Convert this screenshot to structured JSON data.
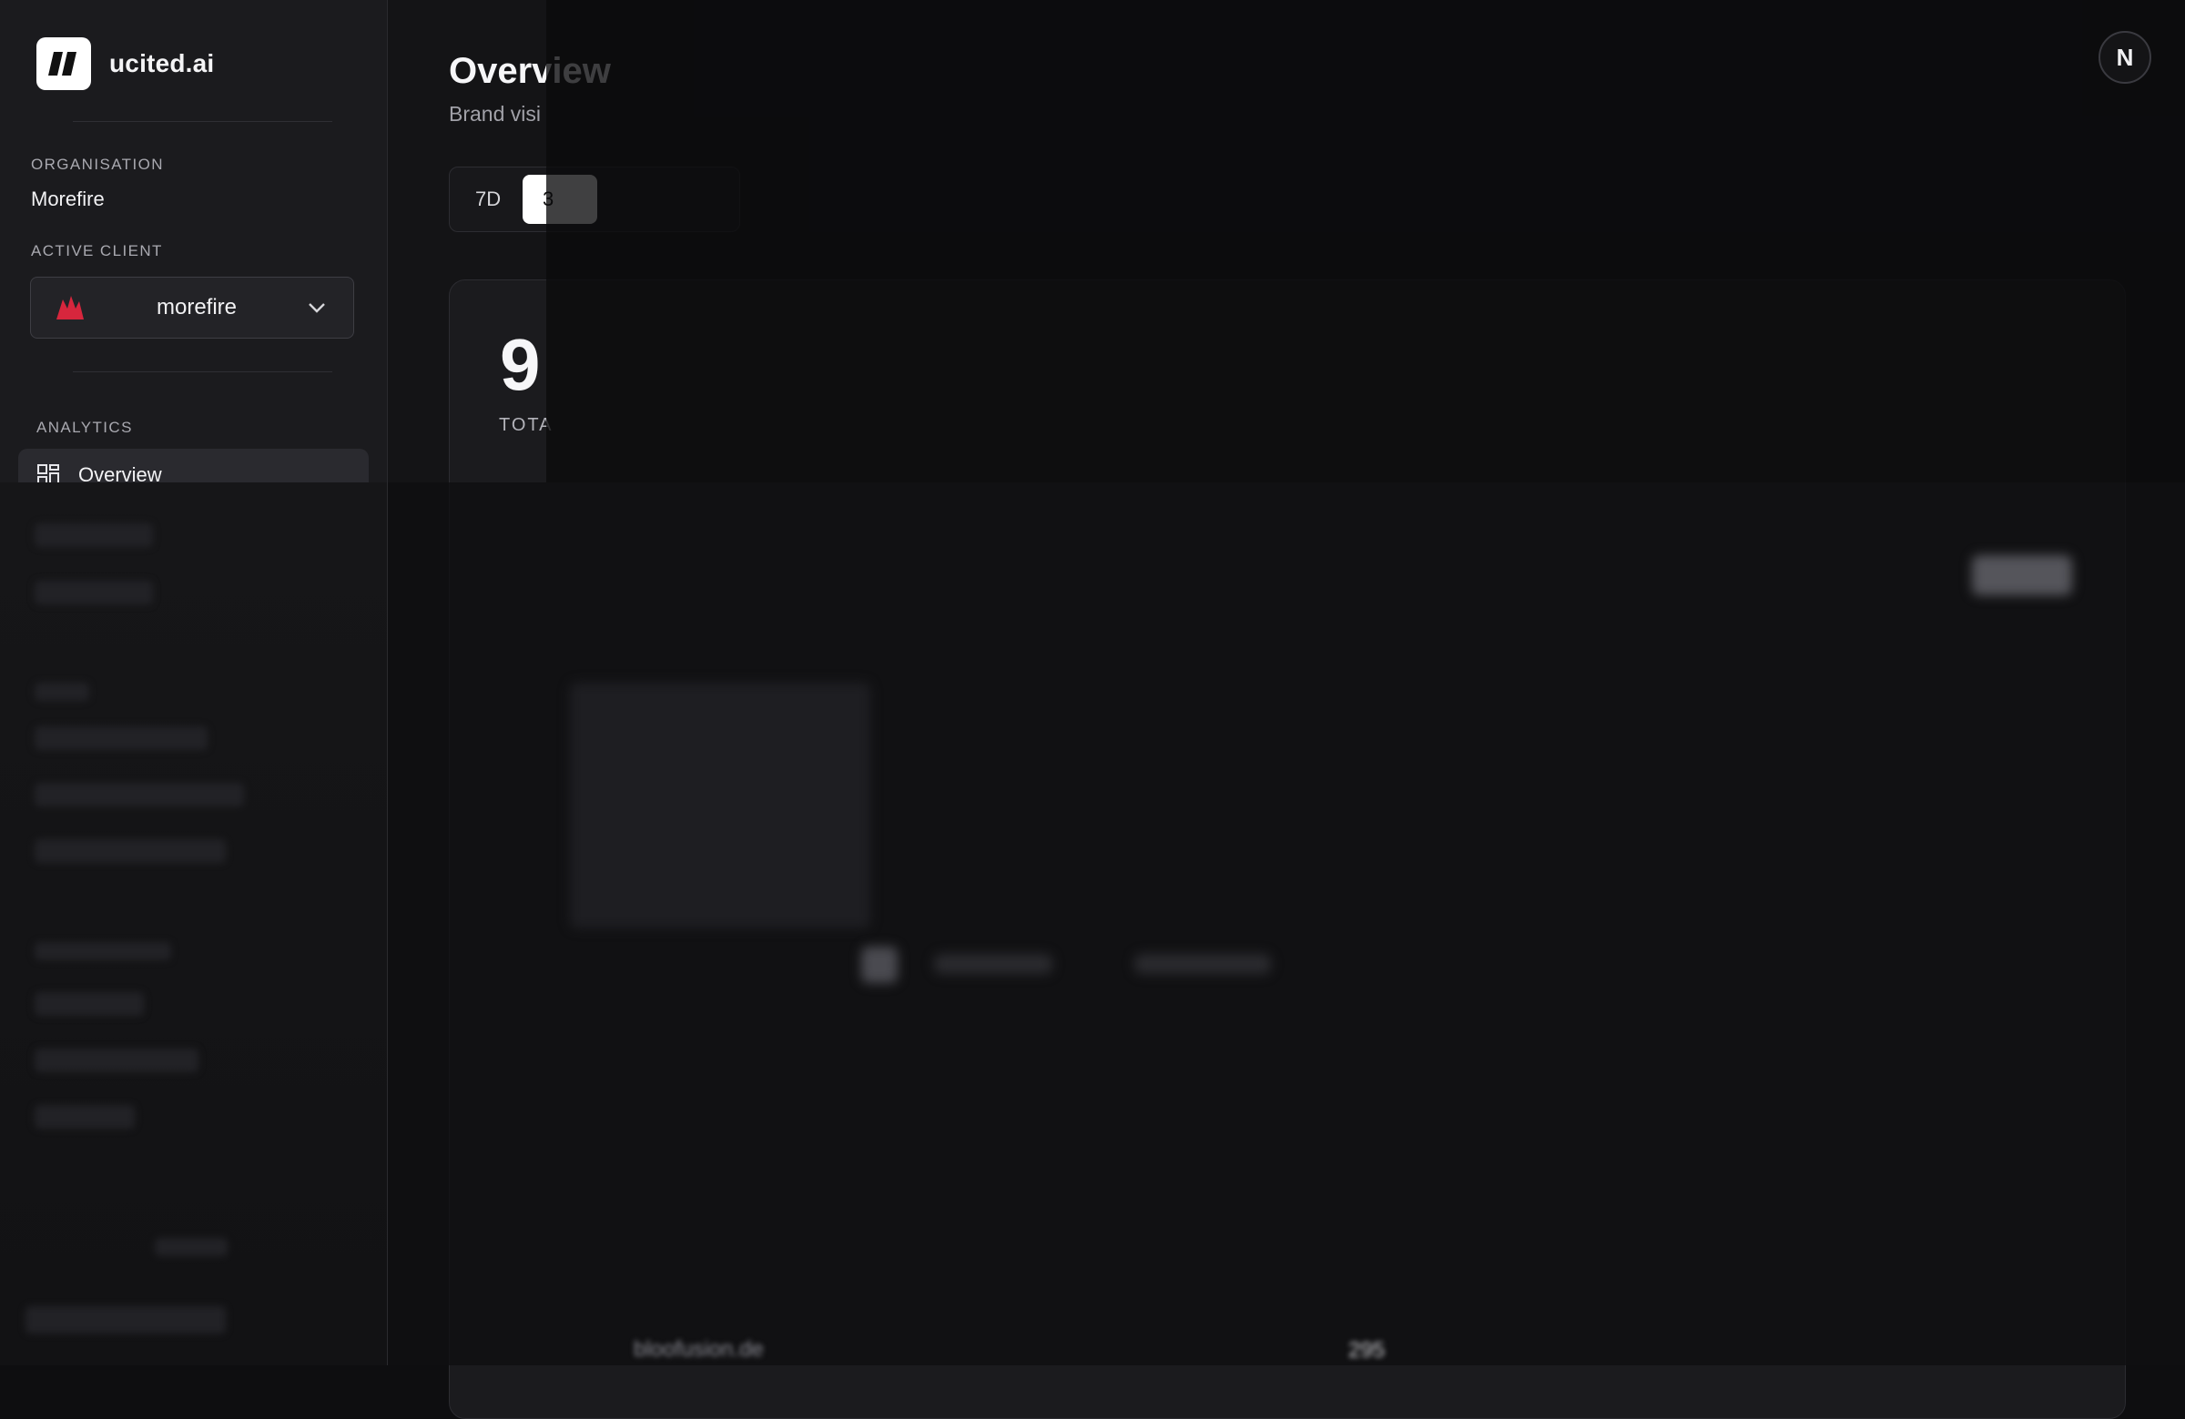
{
  "sidebar": {
    "brand": "ucited.ai",
    "organisation_label": "ORGANISATION",
    "organisation_name": "Morefire",
    "active_client_label": "ACTIVE CLIENT",
    "active_client": "morefire",
    "analytics_label": "ANALYTICS",
    "nav": {
      "overview": "Overview"
    }
  },
  "main": {
    "title": "Overview",
    "subtitle": "Brand visi",
    "range": {
      "r7": "7D",
      "r30": "3"
    },
    "kpi": {
      "value": "9",
      "label": "TOTA"
    },
    "domains": [
      "bloofusion.de"
    ],
    "table": {
      "visits": "295"
    },
    "user_avatar": "N"
  },
  "colors": {
    "accent": "#d7263d",
    "background": "#0e0e10"
  }
}
